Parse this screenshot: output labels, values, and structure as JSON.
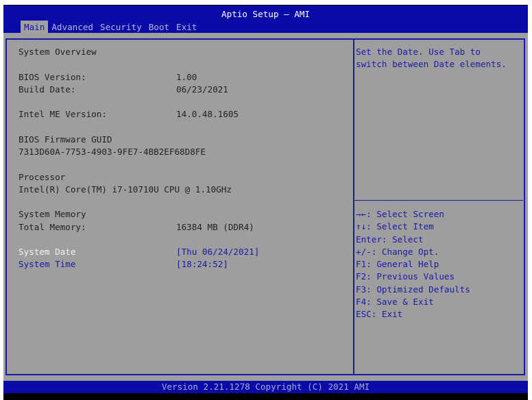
{
  "header": {
    "title": "Aptio Setup – AMI",
    "tabs": [
      "Main",
      "Advanced",
      "Security",
      "Boot",
      "Exit"
    ],
    "active_tab": "Main"
  },
  "main": {
    "section_title": "System Overview",
    "bios_version": {
      "label": "BIOS Version:",
      "value": "1.00"
    },
    "build_date": {
      "label": "Build Date:",
      "value": "06/23/2021"
    },
    "me_version": {
      "label": "Intel ME Version:",
      "value": "14.0.48.1605"
    },
    "guid": {
      "label": "BIOS Firmware GUID",
      "value": "7313D60A-7753-4903-9FE7-4BB2EF68D8FE"
    },
    "processor": {
      "label": "Processor",
      "value": "Intel(R) Core(TM) i7-10710U CPU @ 1.10GHz"
    },
    "memory": {
      "label": "System Memory",
      "total_label": "Total Memory:",
      "total_value": "16384 MB (DDR4)"
    },
    "system_date": {
      "label": "System Date",
      "value": "[Thu 06/24/2021]"
    },
    "system_time": {
      "label": "System Time",
      "value": "[18:24:52]"
    }
  },
  "help": {
    "lines": [
      "Set the Date. Use Tab to",
      "switch between Date elements."
    ]
  },
  "keys": [
    "→←: Select Screen",
    "↑↓: Select Item",
    "Enter: Select",
    "+/-: Change Opt.",
    "F1: General Help",
    "F2: Previous Values",
    "F3: Optimized Defaults",
    "F4: Save & Exit",
    "ESC: Exit"
  ],
  "footer": "Version 2.21.1278 Copyright (C) 2021 AMI",
  "colors": {
    "blue": "#0a0aa6",
    "gray": "#9e9e9e"
  }
}
